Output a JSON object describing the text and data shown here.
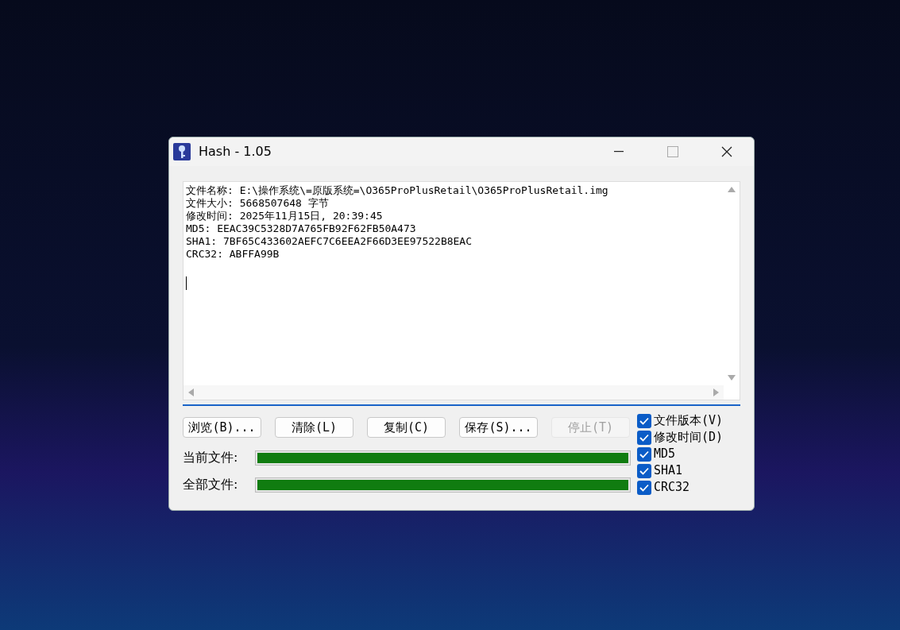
{
  "window": {
    "title": "Hash - 1.05"
  },
  "output": {
    "lines": [
      "文件名称: E:\\操作系统\\=原版系统=\\O365ProPlusRetail\\O365ProPlusRetail.img",
      "文件大小: 5668507648 字节",
      "修改时间: 2025年11月15日, 20:39:45",
      "MD5: EEAC39C5328D7A765FB92F62FB50A473",
      "SHA1: 7BF65C433602AEFC7C6EEA2F66D3EE97522B8EAC",
      "CRC32: ABFFA99B"
    ]
  },
  "buttons": [
    {
      "label": "浏览(B)...",
      "disabled": false
    },
    {
      "label": "清除(L)",
      "disabled": false
    },
    {
      "label": "复制(C)",
      "disabled": false
    },
    {
      "label": "保存(S)...",
      "disabled": false
    },
    {
      "label": "停止(T)",
      "disabled": true
    }
  ],
  "progress": [
    {
      "label": "当前文件:",
      "level": 1
    },
    {
      "label": "全部文件:",
      "level": 1
    }
  ],
  "options": [
    {
      "label": "文件版本(V)",
      "checked": true
    },
    {
      "label": "修改时间(D)",
      "checked": true
    },
    {
      "label": "MD5",
      "checked": true
    },
    {
      "label": "SHA1",
      "checked": true
    },
    {
      "label": "CRC32",
      "checked": true
    }
  ]
}
